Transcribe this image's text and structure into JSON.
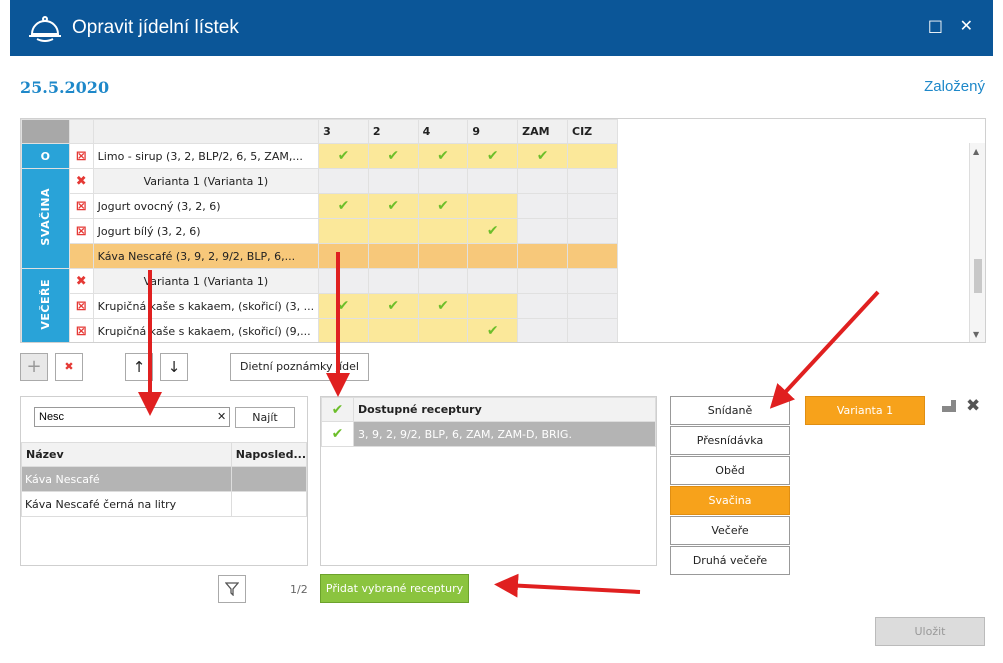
{
  "window": {
    "title": "Opravit jídelní lístek",
    "maximize": "□",
    "close": "✕"
  },
  "header": {
    "date": "25.5.2020",
    "status": "Založený"
  },
  "grid": {
    "columns": [
      "3",
      "2",
      "4",
      "9",
      "ZAM",
      "CIZ"
    ],
    "categories": {
      "top": "O",
      "svacina": "SVAČINA",
      "vecere": "VEČEŘE"
    },
    "rows": [
      {
        "del": "⊠",
        "name": "Limo - sirup (3, 2, BLP/2, 6, 5, ZAM,...",
        "cells": [
          "✔",
          "✔",
          "✔",
          "✔",
          "✔",
          ""
        ]
      },
      {
        "del": "✖",
        "name": "Varianta 1 (Varianta 1)",
        "cells": [
          "",
          "",
          "",
          "",
          "",
          ""
        ]
      },
      {
        "del": "⊠",
        "name": "Jogurt ovocný (3, 2, 6)",
        "cells": [
          "✔",
          "✔",
          "✔",
          "",
          "",
          ""
        ]
      },
      {
        "del": "⊠",
        "name": "Jogurt bílý (3, 2, 6)",
        "cells": [
          "",
          "",
          "",
          "✔",
          "",
          ""
        ]
      },
      {
        "del": "",
        "name": "Káva Nescafé (3, 9, 2, 9/2, BLP, 6,...",
        "cells": [
          "",
          "",
          "",
          "",
          "",
          ""
        ]
      },
      {
        "del": "✖",
        "name": "Varianta 1 (Varianta 1)",
        "cells": [
          "",
          "",
          "",
          "",
          "",
          ""
        ]
      },
      {
        "del": "⊠",
        "name": "Krupičná kaše s kakaem, (skořicí) (3, ...",
        "cells": [
          "✔",
          "✔",
          "✔",
          "",
          "",
          ""
        ]
      },
      {
        "del": "⊠",
        "name": "Krupičná kaše s kakaem, (skořicí) (9,...",
        "cells": [
          "",
          "",
          "",
          "✔",
          "",
          ""
        ]
      }
    ]
  },
  "toolbar": {
    "add": "+",
    "remove": "✖",
    "up": "↑",
    "down": "↓",
    "notes": "Dietní poznámky jídel"
  },
  "search_panel": {
    "value": "Nesc",
    "clear": "✕",
    "find": "Najít",
    "headers": [
      "Název",
      "Naposled..."
    ],
    "items": [
      "Káva Nescafé",
      "Káva Nescafé černá na litry"
    ]
  },
  "recipes_panel": {
    "header": "Dostupné receptury",
    "check": "✔",
    "items": [
      "3, 9, 2, 9/2, BLP, 6, ZAM, ZAM-D, BRIG."
    ]
  },
  "bottom": {
    "filter": "⊽",
    "page": "1/2",
    "add_recipes": "Přidat vybrané receptury"
  },
  "meals": [
    "Snídaně",
    "Přesnídávka",
    "Oběd",
    "Svačina",
    "Večeře",
    "Druhá večeře"
  ],
  "variant": {
    "label": "Varianta 1",
    "close": "✖"
  },
  "save": "Uložit",
  "colors": {
    "accent": "#1e88c9",
    "header": "#0b5698",
    "orange": "#f7a21b",
    "green": "#8bc43f"
  }
}
